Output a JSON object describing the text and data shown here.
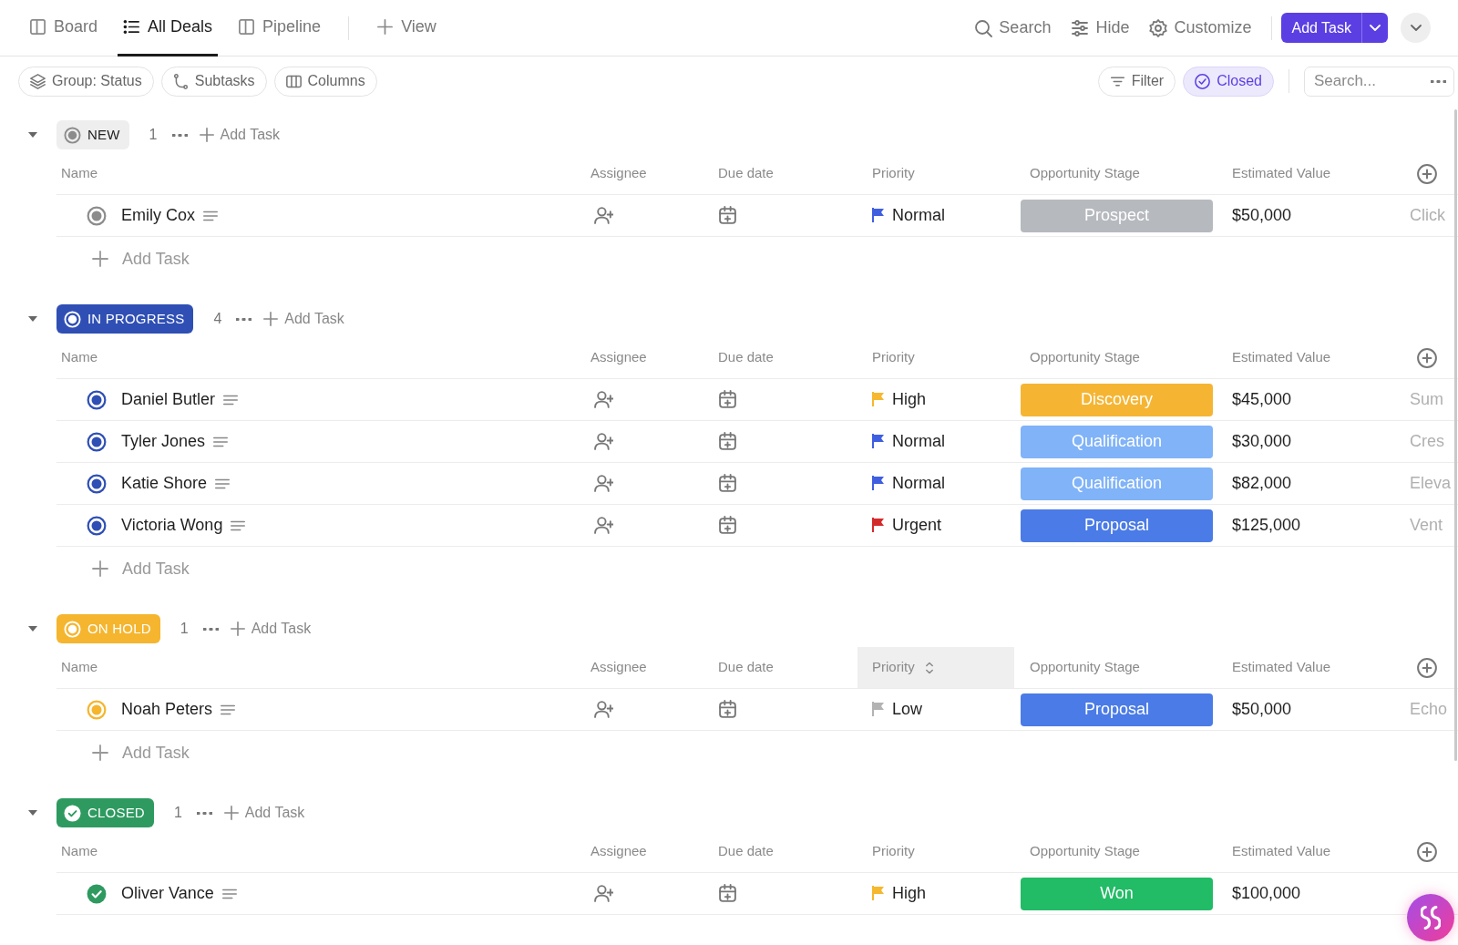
{
  "tabs": [
    {
      "label": "Board",
      "selected": false
    },
    {
      "label": "All Deals",
      "selected": true
    },
    {
      "label": "Pipeline",
      "selected": false
    }
  ],
  "add_view": "View",
  "actions": [
    "Search",
    "Hide",
    "Customize"
  ],
  "add_task_button": "Add Task",
  "chips_left": [
    {
      "label": "Group: Status",
      "selected": false
    },
    {
      "label": "Subtasks",
      "selected": false
    },
    {
      "label": "Columns",
      "selected": false
    }
  ],
  "chips_right": [
    {
      "label": "Filter",
      "selected": false
    },
    {
      "label": "Closed",
      "selected": true
    }
  ],
  "search": {
    "placeholder": "Search..."
  },
  "groups": [
    {
      "status": "NEW",
      "kind": "open",
      "color": "#8c8c8c",
      "count": "1",
      "expanded": true,
      "add_label": "Add Task",
      "columns": [
        {
          "label": "Name",
          "hovered": false
        },
        {
          "label": "Assignee",
          "hovered": false
        },
        {
          "label": "Due date",
          "hovered": false
        },
        {
          "label": "Priority",
          "hovered": false
        },
        {
          "label": "Opportunity Stage",
          "hovered": false
        },
        {
          "label": "Estimated Value",
          "hovered": false
        }
      ],
      "rows": [
        {
          "name": "Emily Cox",
          "priority": {
            "label": "Normal",
            "color": "#3f5fe0"
          },
          "stage": {
            "label": "Prospect",
            "color": "#b6b9be"
          },
          "value": "$50,000",
          "column_7": "Click"
        }
      ],
      "add_row": "Add Task"
    },
    {
      "status": "IN PROGRESS",
      "kind": "active",
      "color": "#2f4fb5",
      "count": "4",
      "expanded": true,
      "add_label": "Add Task",
      "columns": [
        {
          "label": "Name",
          "hovered": false
        },
        {
          "label": "Assignee",
          "hovered": false
        },
        {
          "label": "Due date",
          "hovered": false
        },
        {
          "label": "Priority",
          "hovered": false
        },
        {
          "label": "Opportunity Stage",
          "hovered": false
        },
        {
          "label": "Estimated Value",
          "hovered": false
        }
      ],
      "rows": [
        {
          "name": "Daniel Butler",
          "priority": {
            "label": "High",
            "color": "#f5b82e"
          },
          "stage": {
            "label": "Discovery",
            "color": "#f5b533"
          },
          "value": "$45,000",
          "column_7": "Sum"
        },
        {
          "name": "Tyler Jones",
          "priority": {
            "label": "Normal",
            "color": "#3f5fe0"
          },
          "stage": {
            "label": "Qualification",
            "color": "#80b3f8"
          },
          "value": "$30,000",
          "column_7": "Cres"
        },
        {
          "name": "Katie Shore",
          "priority": {
            "label": "Normal",
            "color": "#3f5fe0"
          },
          "stage": {
            "label": "Qualification",
            "color": "#80b3f8"
          },
          "value": "$82,000",
          "column_7": "Eleva"
        },
        {
          "name": "Victoria Wong",
          "priority": {
            "label": "Urgent",
            "color": "#d42a2a"
          },
          "stage": {
            "label": "Proposal",
            "color": "#4a7be6"
          },
          "value": "$125,000",
          "column_7": "Vent"
        }
      ],
      "add_row": "Add Task"
    },
    {
      "status": "ON HOLD",
      "kind": "active",
      "color": "#f5b52e",
      "count": "1",
      "expanded": true,
      "add_label": "Add Task",
      "columns": [
        {
          "label": "Name",
          "hovered": false
        },
        {
          "label": "Assignee",
          "hovered": false
        },
        {
          "label": "Due date",
          "hovered": false
        },
        {
          "label": "Priority",
          "hovered": true
        },
        {
          "label": "Opportunity Stage",
          "hovered": false
        },
        {
          "label": "Estimated Value",
          "hovered": false
        }
      ],
      "rows": [
        {
          "name": "Noah Peters",
          "priority": {
            "label": "Low",
            "color": "#b3b3b3"
          },
          "stage": {
            "label": "Proposal",
            "color": "#4a7be6"
          },
          "value": "$50,000",
          "column_7": "Echo"
        }
      ],
      "add_row": "Add Task"
    },
    {
      "status": "CLOSED",
      "kind": "done",
      "color": "#2e9a60",
      "count": "1",
      "expanded": true,
      "add_label": "Add Task",
      "columns": [
        {
          "label": "Name",
          "hovered": false
        },
        {
          "label": "Assignee",
          "hovered": false
        },
        {
          "label": "Due date",
          "hovered": false
        },
        {
          "label": "Priority",
          "hovered": false
        },
        {
          "label": "Opportunity Stage",
          "hovered": false
        },
        {
          "label": "Estimated Value",
          "hovered": false
        }
      ],
      "rows": [
        {
          "name": "Oliver Vance",
          "priority": {
            "label": "High",
            "color": "#f5b82e"
          },
          "stage": {
            "label": "Won",
            "color": "#22bb66"
          },
          "value": "$100,000"
        }
      ]
    }
  ]
}
